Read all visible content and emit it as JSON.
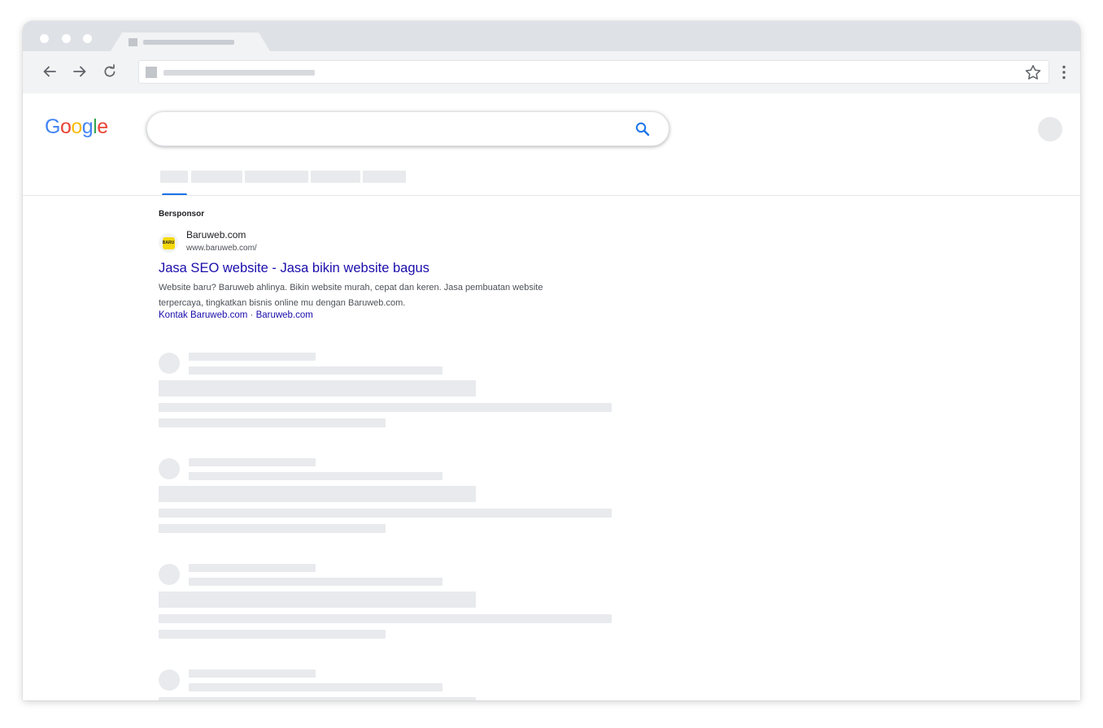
{
  "browser": {
    "tab_icon": "placeholder-favicon",
    "nav_icons": [
      "back-arrow-icon",
      "forward-arrow-icon",
      "reload-icon"
    ],
    "omnibox_icons": [
      "bookmark-star-icon"
    ],
    "menu_icon": "kebab-menu-icon"
  },
  "google": {
    "logo_letters": [
      "G",
      "o",
      "o",
      "g",
      "l",
      "e"
    ],
    "logo_colors": [
      "#4285F4",
      "#EA4335",
      "#FBBC05",
      "#4285F4",
      "#34A853",
      "#EA4335"
    ],
    "search_icon": "search-icon",
    "search_value": "",
    "accent": "#1a73e8"
  },
  "ad": {
    "label": "Bersponsor",
    "site_name": "Baruweb.com",
    "display_url": "www.baruweb.com/",
    "title": "Jasa SEO website - Jasa bikin website bagus",
    "description": "Website baru? Baruweb ahlinya. Bikin website murah, cepat dan keren. Jasa pembuatan website terpercaya, tingkatkan bisnis online mu dengan Baruweb.com.",
    "sitelinks": [
      "Kontak Baruweb.com",
      "Baruweb.com"
    ],
    "sitelink_separator": "·",
    "link_color": "#1a0dab"
  }
}
